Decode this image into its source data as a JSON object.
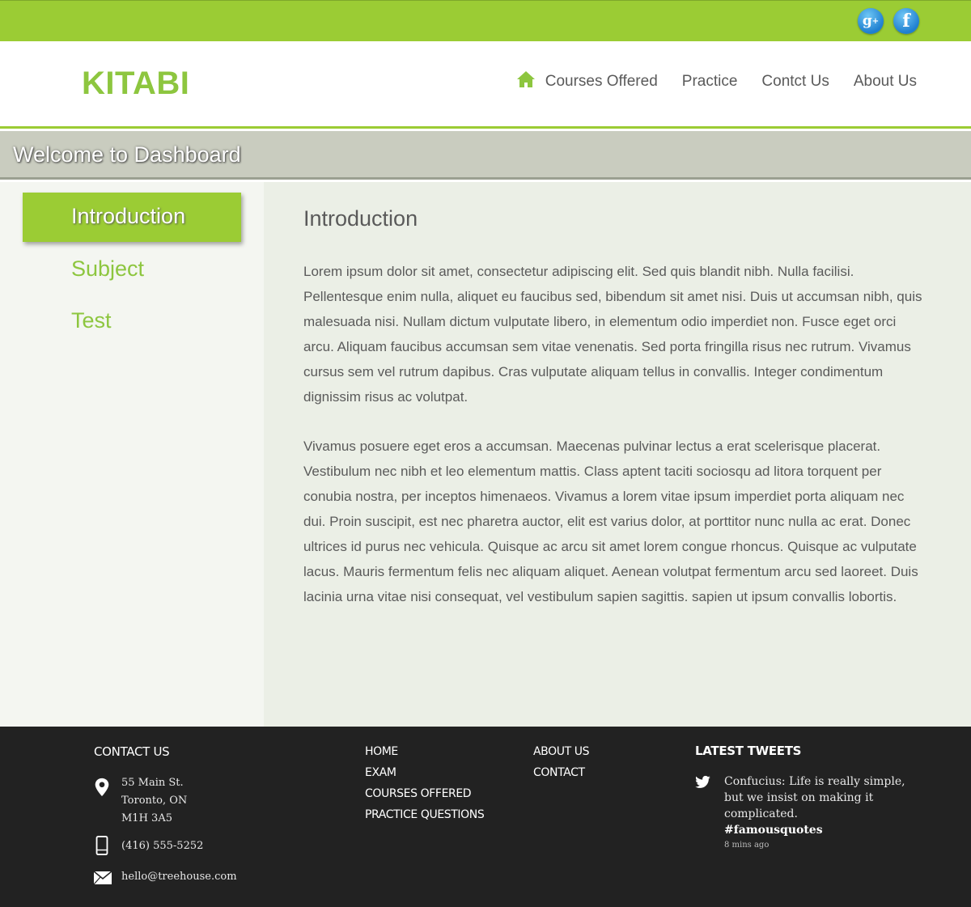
{
  "colors": {
    "accent": "#9bcc34",
    "logo": "#8dc63f",
    "banner": "#c9ccbf",
    "footer": "#222222"
  },
  "social": {
    "gplus_icon": "google-plus-icon",
    "gplus_label": "g",
    "fb_icon": "facebook-icon",
    "fb_label": "f"
  },
  "header": {
    "logo": "KITABI",
    "nav": [
      {
        "label": "Courses Offered",
        "icon": "home-icon"
      },
      {
        "label": "Practice"
      },
      {
        "label": "Contct Us"
      },
      {
        "label": "About Us"
      }
    ]
  },
  "banner": {
    "title": "Welcome to Dashboard"
  },
  "sidebar": {
    "items": [
      {
        "label": "Introduction",
        "active": true
      },
      {
        "label": "Subject"
      },
      {
        "label": "Test"
      }
    ]
  },
  "main": {
    "heading": "Introduction",
    "paragraphs": [
      " Lorem ipsum dolor sit amet, consectetur adipiscing elit. Sed quis blandit nibh. Nulla facilisi. Pellentesque enim nulla, aliquet eu faucibus sed, bibendum sit amet nisi. Duis ut accumsan nibh, quis malesuada nisi. Nullam dictum vulputate libero, in elementum odio imperdiet non. Fusce eget orci arcu. Aliquam faucibus accumsan sem vitae venenatis. Sed porta fringilla risus nec rutrum. Vivamus cursus sem vel rutrum dapibus. Cras vulputate aliquam tellus in convallis. Integer condimentum dignissim risus ac volutpat.",
      "Vivamus posuere eget eros a accumsan. Maecenas pulvinar lectus a erat scelerisque placerat. Vestibulum nec nibh et leo elementum mattis. Class aptent taciti sociosqu ad litora torquent per conubia nostra, per inceptos himenaeos. Vivamus a lorem vitae ipsum imperdiet porta aliquam nec dui. Proin suscipit, est nec pharetra auctor, elit est varius dolor, at porttitor nunc nulla ac erat. Donec ultrices id purus nec vehicula. Quisque ac arcu sit amet lorem congue rhoncus. Quisque ac vulputate lacus. Mauris fermentum felis nec aliquam aliquet. Aenean volutpat fermentum arcu sed laoreet. Duis lacinia urna vitae nisi consequat, vel vestibulum sapien sagittis. sapien ut ipsum convallis lobortis."
    ]
  },
  "footer": {
    "contact": {
      "heading": "CONTACT US",
      "address_line1": "55 Main St.",
      "address_line2": "Toronto, ON",
      "address_line3": "M1H 3A5",
      "phone": "(416) 555-5252",
      "email": "hello@treehouse.com"
    },
    "links_col1": [
      "HOME",
      "EXAM",
      "COURSES OFFERED",
      "PRACTICE QUESTIONS"
    ],
    "links_col2": [
      "ABOUT US",
      "CONTACT"
    ],
    "tweets": {
      "heading": "LATEST TWEETS",
      "text": "Confucius: Life is really simple, but we insist on making it complicated.",
      "hashtag": "#famousquotes",
      "time": "8 mins ago"
    }
  }
}
